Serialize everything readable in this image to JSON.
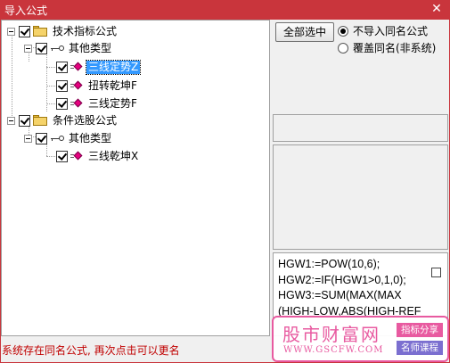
{
  "window": {
    "title": "导入公式",
    "close_glyph": "✕"
  },
  "tree": {
    "root1": {
      "label": "技术指标公式",
      "checked": true
    },
    "root1_child": {
      "label": "其他类型",
      "checked": true
    },
    "root1_items": [
      {
        "label": "三线定势Z",
        "checked": true,
        "selected": true
      },
      {
        "label": "扭转乾坤F",
        "checked": true,
        "selected": false
      },
      {
        "label": "三线定势F",
        "checked": true,
        "selected": false
      }
    ],
    "root2": {
      "label": "条件选股公式",
      "checked": true
    },
    "root2_child": {
      "label": "其他类型",
      "checked": true
    },
    "root2_items": [
      {
        "label": "三线乾坤X",
        "checked": true,
        "selected": false
      }
    ]
  },
  "actions": {
    "select_all_label": "全部选中",
    "radio_no_import_label": "不导入同名公式",
    "radio_overwrite_label": "覆盖同名(非系统)",
    "selected_option": "不导入同名公式"
  },
  "code_lines": [
    "HGW1:=POW(10,6);",
    "HGW2:=IF(HGW1>0,1,0);",
    "HGW3:=SUM(MAX(MAX",
    "(HIGH-LOW,ABS(HIGH-REF"
  ],
  "status_text": "系统存在同名公式, 再次点击可以更名",
  "watermark": {
    "name": "股市财富网",
    "url": "WWW.GSCFW.COM",
    "tag1": "指标分享",
    "tag2": "名师课程"
  },
  "colors": {
    "titlebar": "#c9353c",
    "selection": "#3399ff",
    "status_text": "#c00000",
    "watermark_pink": "#e85aa0",
    "watermark_purple": "#7b6fd0"
  }
}
